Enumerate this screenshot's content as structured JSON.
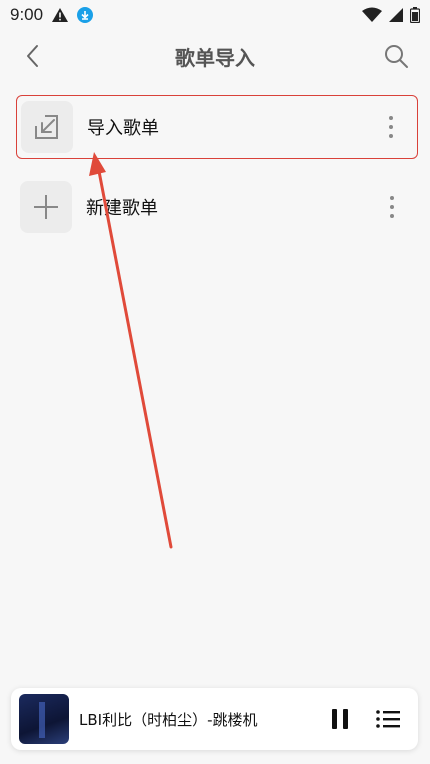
{
  "status_bar": {
    "time": "9:00"
  },
  "header": {
    "title": "歌单导入"
  },
  "rows": [
    {
      "label": "导入歌单"
    },
    {
      "label": "新建歌单"
    }
  ],
  "player": {
    "song": "LBI利比（时柏尘）-跳楼机"
  },
  "colors": {
    "highlight": "#d9413a",
    "download_badge": "#1aa0e8"
  }
}
